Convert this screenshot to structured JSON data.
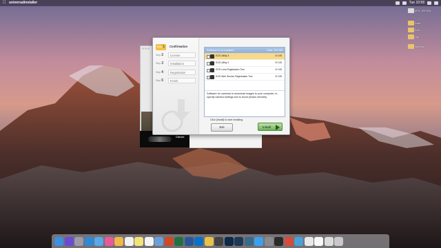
{
  "menubar": {
    "app_name": "universalinstaller",
    "clock": "Tue 10:58"
  },
  "desktop_icons": [
    {
      "label": "APS_Z0071NL",
      "color": "#dcdcdc"
    },
    {
      "label": "Docs",
      "color": "#e8c46a"
    },
    {
      "label": "Fold",
      "color": "#e8c46a"
    },
    {
      "label": "Clip",
      "color": "#e8c46a"
    },
    {
      "label": "SanDisk",
      "color": "#e8c46a"
    }
  ],
  "installer": {
    "steps": [
      {
        "num": "1",
        "prefix": "Step",
        "label": "Confirmation",
        "active": true
      },
      {
        "num": "2",
        "prefix": "Step",
        "label": "License",
        "active": false
      },
      {
        "num": "3",
        "prefix": "Step",
        "label": "Installation",
        "active": false
      },
      {
        "num": "4",
        "prefix": "Step",
        "label": "Registration",
        "active": false
      },
      {
        "num": "5",
        "prefix": "Step",
        "label": "Finish",
        "active": false
      }
    ],
    "software_header": "Software to be installed",
    "total": "Total: 100 MB",
    "software": [
      {
        "name": "EOS Utility 3",
        "size": "00 MB",
        "selected": true
      },
      {
        "name": "EOS Utility 2",
        "size": "00 MB",
        "selected": false
      },
      {
        "name": "EOS Lens Registration Tool",
        "size": "00 MB",
        "selected": false
      },
      {
        "name": "EOS Web Service Registration Tool",
        "size": "00 MB",
        "selected": false
      }
    ],
    "description": "Software for cameras to download images to your computer, to specify camera settings and to shoot photos remotely.",
    "hint": "Click [Install] to start installing.",
    "exit_label": "Exit",
    "install_label": "Install"
  },
  "background_window": {
    "brand": "Canon"
  },
  "dock": {
    "apps": [
      {
        "name": "finder-icon",
        "color": "#3d8fe0"
      },
      {
        "name": "siri-icon",
        "color": "#6b4ad6"
      },
      {
        "name": "launchpad-icon",
        "color": "#9a9aa8"
      },
      {
        "name": "safari-icon",
        "color": "#2d8ad8"
      },
      {
        "name": "mail-icon",
        "color": "#5aa8e8"
      },
      {
        "name": "itunes-icon",
        "color": "#e85a9a"
      },
      {
        "name": "photos-icon",
        "color": "#f0b84a"
      },
      {
        "name": "calendar-icon",
        "color": "#f2f2f2"
      },
      {
        "name": "notes-icon",
        "color": "#f2e27a"
      },
      {
        "name": "reminders-icon",
        "color": "#f4f4f4"
      },
      {
        "name": "preview-icon",
        "color": "#6aa0d8"
      },
      {
        "name": "powerpoint-icon",
        "color": "#d24726"
      },
      {
        "name": "excel-icon",
        "color": "#1f7244"
      },
      {
        "name": "word-icon",
        "color": "#2b579a"
      },
      {
        "name": "outlook-icon",
        "color": "#0a72c6"
      },
      {
        "name": "chrome-icon",
        "color": "#e8c248"
      },
      {
        "name": "camera-icon",
        "color": "#444444"
      },
      {
        "name": "photoshop-icon",
        "color": "#0c2a4a"
      },
      {
        "name": "lightroom-icon",
        "color": "#1d3a52"
      },
      {
        "name": "lightroom-classic-icon",
        "color": "#3a6a8a"
      },
      {
        "name": "app-store-icon",
        "color": "#3aa0f0"
      },
      {
        "name": "system-preferences-icon",
        "color": "#8a8a90"
      },
      {
        "name": "camera-raw-icon",
        "color": "#2a2a2a"
      },
      {
        "name": "chrome2-icon",
        "color": "#d84a3a"
      },
      {
        "name": "trash-blue-icon",
        "color": "#4aa0d8"
      },
      {
        "name": "messages-icon",
        "color": "#e8e8e8"
      },
      {
        "name": "doc-icon",
        "color": "#f8f8f8"
      },
      {
        "name": "downloads-icon",
        "color": "#dcdcdc"
      },
      {
        "name": "trash-icon",
        "color": "#c8c8cc"
      }
    ]
  }
}
